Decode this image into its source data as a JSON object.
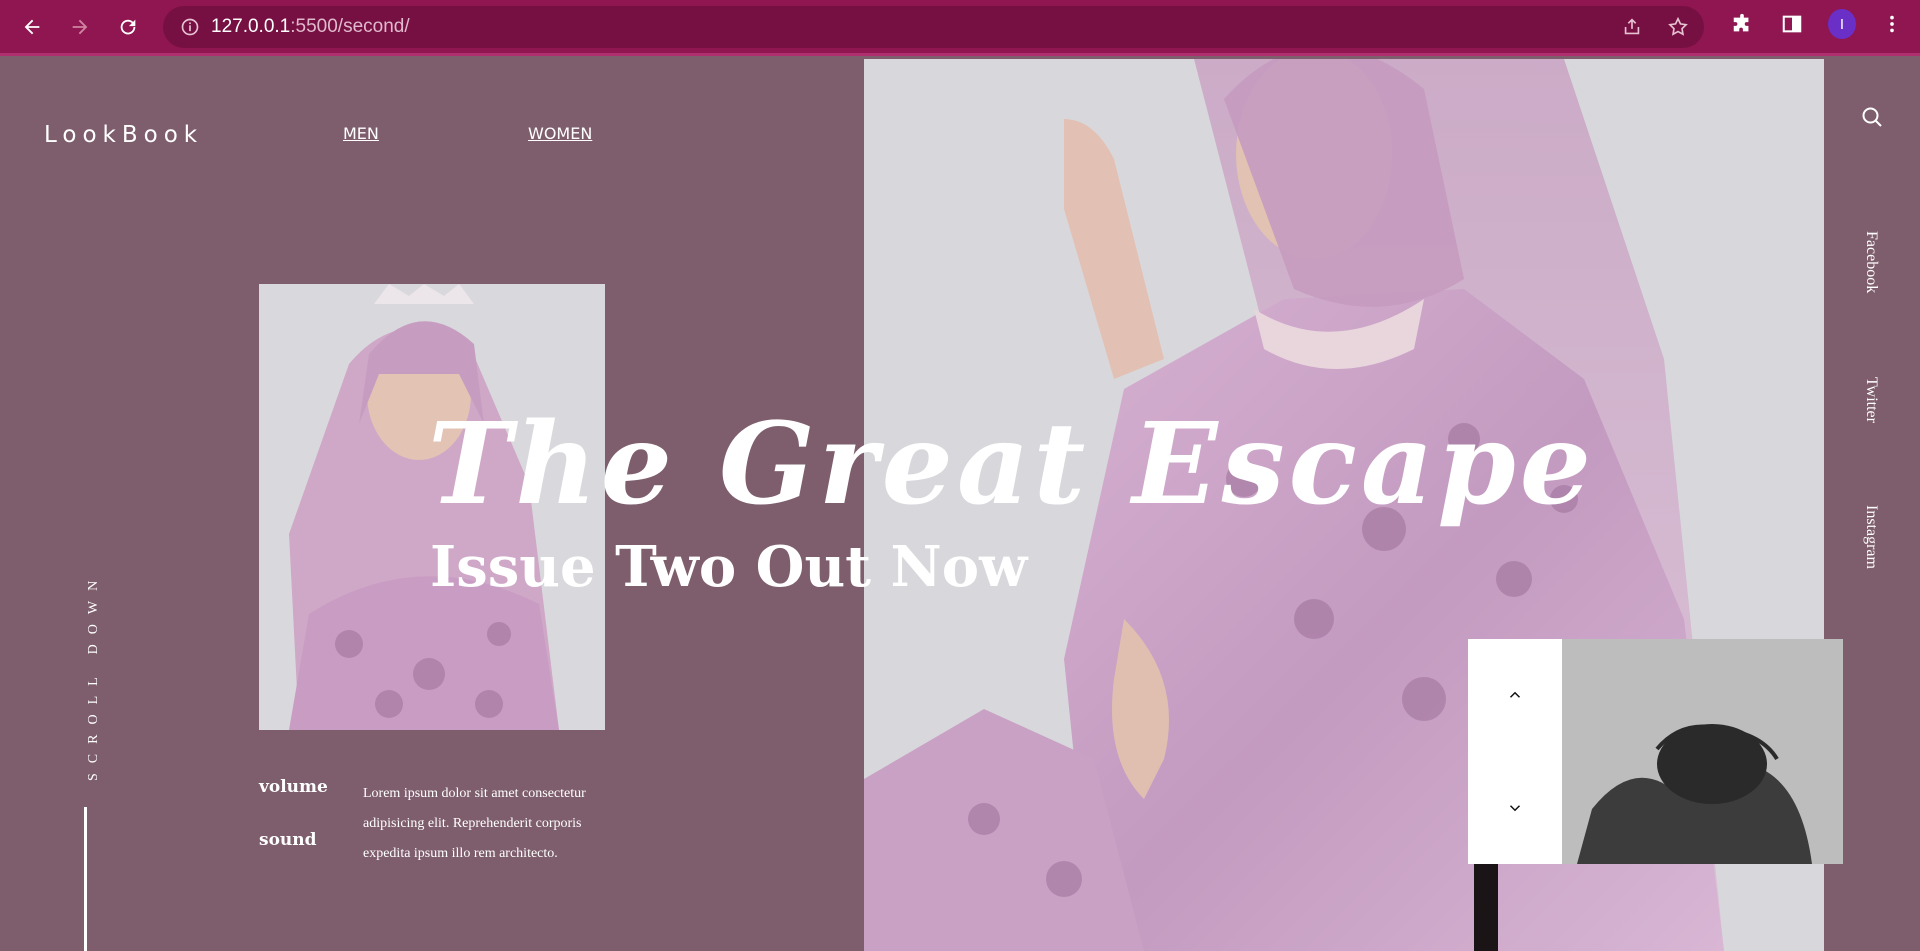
{
  "browser": {
    "url_host": "127.0.0.1",
    "url_path": ":5500/second/",
    "profile_initial": "I"
  },
  "site": {
    "brand": "LookBook",
    "nav": {
      "men": "MEN",
      "women": "WOMEN"
    }
  },
  "hero": {
    "title": "The Great Escape",
    "subtitle": "Issue Two Out Now"
  },
  "details": {
    "volume_label": "volume",
    "sound_label": "sound",
    "body": "Lorem ipsum dolor sit amet consectetur adipisicing elit. Reprehenderit corporis expedita ipsum illo rem architecto."
  },
  "scroll": {
    "label": "SCROLL DOWN"
  },
  "social": {
    "facebook": "Facebook",
    "twitter": "Twitter",
    "instagram": "Instagram"
  },
  "colors": {
    "chrome": "#8f1651",
    "omnibox": "#771042",
    "page_bg": "#7e5e6c",
    "hero_bg": "#d7d6da"
  },
  "icons": [
    "back-icon",
    "forward-icon",
    "reload-icon",
    "info-icon",
    "share-icon",
    "star-icon",
    "extensions-icon",
    "sidepanel-icon",
    "menu-icon",
    "search-icon",
    "chevron-up-icon",
    "chevron-down-icon"
  ]
}
